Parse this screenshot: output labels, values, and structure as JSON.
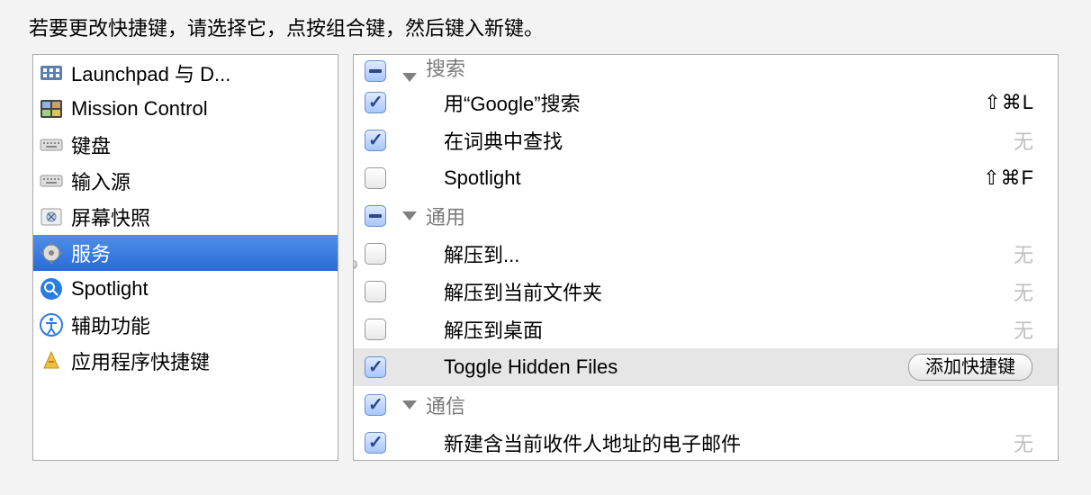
{
  "instruction": "若要更改快捷键，请选择它，点按组合键，然后键入新键。",
  "sidebar": {
    "items": [
      {
        "label": "Launchpad 与 D...",
        "icon": "launchpad"
      },
      {
        "label": "Mission Control",
        "icon": "mission-control"
      },
      {
        "label": "键盘",
        "icon": "keyboard"
      },
      {
        "label": "输入源",
        "icon": "input-source"
      },
      {
        "label": "屏幕快照",
        "icon": "screenshot"
      },
      {
        "label": "服务",
        "icon": "services",
        "selected": true
      },
      {
        "label": "Spotlight",
        "icon": "spotlight"
      },
      {
        "label": "辅助功能",
        "icon": "accessibility"
      },
      {
        "label": "应用程序快捷键",
        "icon": "app-shortcuts"
      }
    ]
  },
  "services": {
    "group0": {
      "label": "搜索",
      "checkbox": "mixed"
    },
    "item0": {
      "label": "用“Google”搜索",
      "checked": true,
      "shortcut": "⇧⌘L"
    },
    "item1": {
      "label": "在词典中查找",
      "checked": true,
      "shortcut": "无",
      "none": true
    },
    "item2": {
      "label": "Spotlight",
      "checked": false,
      "shortcut": "⇧⌘F"
    },
    "group1": {
      "label": "通用",
      "checkbox": "mixed"
    },
    "item3": {
      "label": "解压到...",
      "checked": false,
      "shortcut": "无",
      "none": true
    },
    "item4": {
      "label": "解压到当前文件夹",
      "checked": false,
      "shortcut": "无",
      "none": true
    },
    "item5": {
      "label": "解压到桌面",
      "checked": false,
      "shortcut": "无",
      "none": true
    },
    "item6": {
      "label": "Toggle Hidden Files",
      "checked": true,
      "selected": true,
      "addButtonLabel": "添加快捷键"
    },
    "group2": {
      "label": "通信",
      "checkbox": "checked"
    },
    "item7": {
      "label": "新建含当前收件人地址的电子邮件",
      "checked": true,
      "shortcut": "无",
      "none": true
    }
  }
}
